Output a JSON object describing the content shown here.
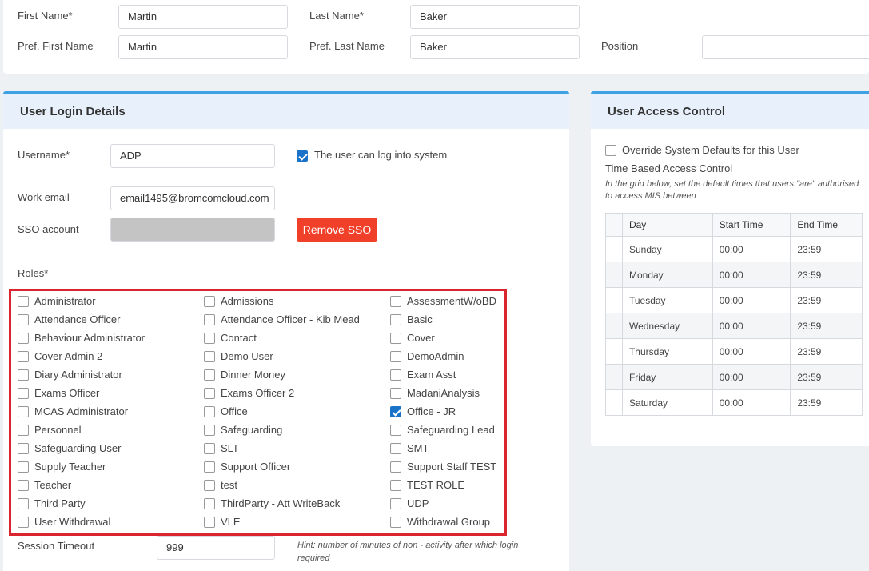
{
  "personal": {
    "first_name_label": "First Name*",
    "first_name_value": "Martin",
    "last_name_label": "Last Name*",
    "last_name_value": "Baker",
    "pref_first_label": "Pref. First Name",
    "pref_first_value": "Martin",
    "pref_last_label": "Pref. Last Name",
    "pref_last_value": "Baker",
    "position_label": "Position",
    "position_value": ""
  },
  "login": {
    "title": "User Login Details",
    "username_label": "Username*",
    "username_value": "ADP",
    "can_login_label": "The user can log into system",
    "can_login_checked": true,
    "work_email_label": "Work email",
    "work_email_value": "email1495@bromcomcloud.com",
    "sso_label": "SSO account",
    "remove_sso_label": "Remove SSO",
    "roles_label": "Roles*",
    "roles": [
      [
        "Administrator",
        "Admissions",
        "AssessmentW/oBD"
      ],
      [
        "Attendance Officer",
        "Attendance Officer - Kib Mead",
        "Basic"
      ],
      [
        "Behaviour Administrator",
        "Contact",
        "Cover"
      ],
      [
        "Cover Admin 2",
        "Demo User",
        "DemoAdmin"
      ],
      [
        "Diary Administrator",
        "Dinner Money",
        "Exam Asst"
      ],
      [
        "Exams Officer",
        "Exams Officer 2",
        "MadaniAnalysis"
      ],
      [
        "MCAS Administrator",
        "Office",
        "Office - JR"
      ],
      [
        "Personnel",
        "Safeguarding",
        "Safeguarding Lead"
      ],
      [
        "Safeguarding User",
        "SLT",
        "SMT"
      ],
      [
        "Supply Teacher",
        "Support Officer",
        "Support Staff TEST"
      ],
      [
        "Teacher",
        "test",
        "TEST ROLE"
      ],
      [
        "Third Party",
        "ThirdParty - Att WriteBack",
        "UDP"
      ],
      [
        "User Withdrawal",
        "VLE",
        "Withdrawal Group"
      ]
    ],
    "checked_roles": [
      "Office - JR"
    ],
    "session_timeout_label": "Session Timeout",
    "session_timeout_value": "999",
    "session_hint": "Hint: number of minutes of non - activity after which login required"
  },
  "access": {
    "title": "User Access Control",
    "override_label": "Override System Defaults for this User",
    "tbac_label": "Time Based Access Control",
    "grid_hint": "In the grid below, set the default times that users \"are\" authorised to access MIS between",
    "columns": [
      "Day",
      "Start Time",
      "End Time"
    ],
    "rows": [
      [
        "Sunday",
        "00:00",
        "23:59"
      ],
      [
        "Monday",
        "00:00",
        "23:59"
      ],
      [
        "Tuesday",
        "00:00",
        "23:59"
      ],
      [
        "Wednesday",
        "00:00",
        "23:59"
      ],
      [
        "Thursday",
        "00:00",
        "23:59"
      ],
      [
        "Friday",
        "00:00",
        "23:59"
      ],
      [
        "Saturday",
        "00:00",
        "23:59"
      ]
    ]
  },
  "colors": {
    "accent": "#3ea1e4",
    "danger": "#f0402a",
    "highlight_border": "#d9262e",
    "checkbox_checked": "#1a73c9"
  }
}
